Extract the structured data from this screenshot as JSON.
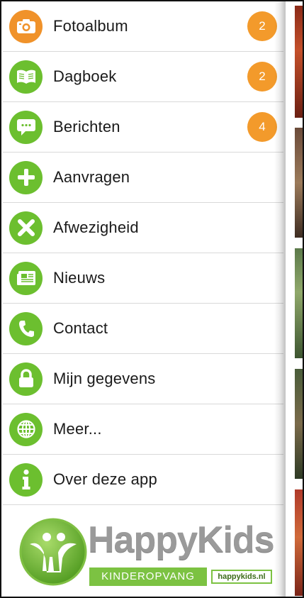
{
  "menu": {
    "items": [
      {
        "label": "Fotoalbum",
        "icon": "camera-icon",
        "color": "#f0922a",
        "badge": "2"
      },
      {
        "label": "Dagboek",
        "icon": "book-icon",
        "color": "#6cbf2f",
        "badge": "2"
      },
      {
        "label": "Berichten",
        "icon": "chat-icon",
        "color": "#6cbf2f",
        "badge": "4"
      },
      {
        "label": "Aanvragen",
        "icon": "plus-icon",
        "color": "#6cbf2f"
      },
      {
        "label": "Afwezigheid",
        "icon": "close-icon",
        "color": "#6cbf2f"
      },
      {
        "label": "Nieuws",
        "icon": "newspaper-icon",
        "color": "#6cbf2f"
      },
      {
        "label": "Contact",
        "icon": "phone-icon",
        "color": "#6cbf2f"
      },
      {
        "label": "Mijn gegevens",
        "icon": "lock-icon",
        "color": "#6cbf2f"
      },
      {
        "label": "Meer...",
        "icon": "globe-icon",
        "color": "#6cbf2f"
      },
      {
        "label": "Over deze app",
        "icon": "info-icon",
        "color": "#6cbf2f"
      }
    ]
  },
  "logo": {
    "name": "HappyKids",
    "tagline": "KINDEROPVANG",
    "url": "happykids.nl"
  },
  "colors": {
    "accent_green": "#6cbf2f",
    "badge_orange": "#f39a2b",
    "logo_grey": "#9a9a9a"
  }
}
